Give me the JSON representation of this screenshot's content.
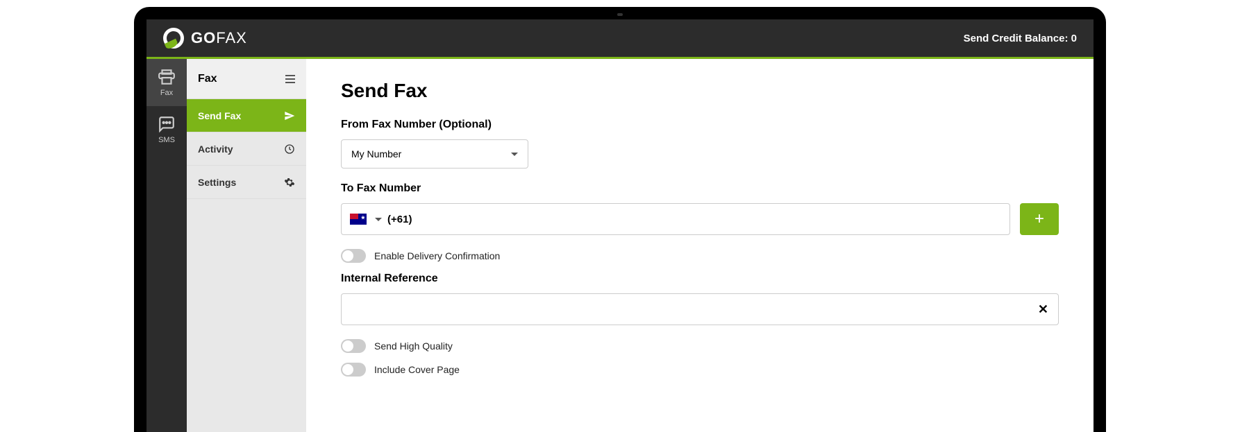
{
  "brand": {
    "part1": "GO",
    "part2": "FAX"
  },
  "header": {
    "balance_text": "Send Credit Balance: 0"
  },
  "navRail": {
    "items": [
      {
        "label": "Fax",
        "active": true
      },
      {
        "label": "SMS",
        "active": false
      }
    ]
  },
  "sidebar": {
    "header": "Fax",
    "items": [
      {
        "label": "Send Fax",
        "active": true
      },
      {
        "label": "Activity",
        "active": false
      },
      {
        "label": "Settings",
        "active": false
      }
    ]
  },
  "page": {
    "title": "Send Fax",
    "from_label": "From Fax Number (Optional)",
    "from_selected": "My Number",
    "to_label": "To Fax Number",
    "country_code": "(+61)",
    "toggle_delivery": "Enable Delivery Confirmation",
    "internal_ref_label": "Internal Reference",
    "internal_ref_value": "",
    "toggle_hq": "Send High Quality",
    "toggle_cover": "Include Cover Page"
  }
}
